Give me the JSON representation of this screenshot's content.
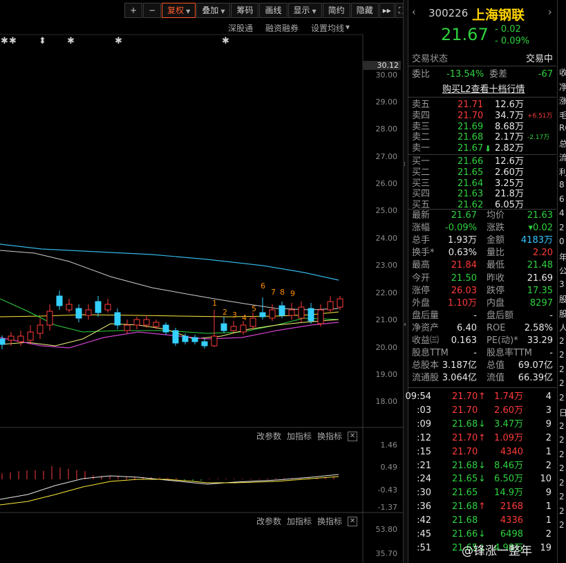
{
  "toolbar": {
    "buttons": [
      "+",
      "−",
      "复权",
      "叠加",
      "筹码",
      "画线",
      "显示",
      "简约",
      "隐藏"
    ],
    "icons": [
      "double-arrow-icon",
      "expand-icon"
    ]
  },
  "subbar": [
    "深股通",
    "融资融券",
    "设置均线"
  ],
  "price_axis": [
    "30.12",
    "30.00",
    "29.00",
    "28.00",
    "27.00",
    "26.00",
    "25.00",
    "24.00",
    "23.00",
    "22.00",
    "21.00",
    "20.00",
    "19.00",
    "18.00"
  ],
  "chart_markers": [
    "1",
    "2",
    "3",
    "4",
    "5",
    "6",
    "7",
    "8",
    "9"
  ],
  "panel_bar": {
    "params": "改参数",
    "add": "加指标",
    "switch": "换指标"
  },
  "macd_axis": [
    "1.46",
    "0.49",
    "-0.43",
    "-1.37"
  ],
  "vol_axis": [
    "53.80",
    "35.70"
  ],
  "stock": {
    "code": "300226",
    "name": "上海钢联",
    "price": "21.67",
    "change": "- 0.02",
    "change_pct": "- 0.09%"
  },
  "status": {
    "label": "交易状态",
    "value": "交易中"
  },
  "weibi": {
    "label1": "委比",
    "val1": "-13.54%",
    "label2": "委差",
    "val2": "-67"
  },
  "l2_link": "购买L2查看十档行情",
  "sells": [
    {
      "label": "卖五",
      "price": "21.71",
      "vol": "12.6万",
      "extra": ""
    },
    {
      "label": "卖四",
      "price": "21.70",
      "vol": "34.7万",
      "extra": "+6.51万"
    },
    {
      "label": "卖三",
      "price": "21.69",
      "vol": "8.68万",
      "extra": ""
    },
    {
      "label": "卖二",
      "price": "21.68",
      "vol": "2.17万",
      "extra": "-2.17万"
    },
    {
      "label": "卖一",
      "price": "21.67",
      "vol": "2.82万",
      "extra": ""
    }
  ],
  "buys": [
    {
      "label": "买一",
      "price": "21.66",
      "vol": "12.6万"
    },
    {
      "label": "买二",
      "price": "21.65",
      "vol": "2.60万"
    },
    {
      "label": "买三",
      "price": "21.64",
      "vol": "3.25万"
    },
    {
      "label": "买四",
      "price": "21.63",
      "vol": "21.8万"
    },
    {
      "label": "买五",
      "price": "21.62",
      "vol": "6.05万"
    }
  ],
  "stats": [
    {
      "l1": "最新",
      "v1": "21.67",
      "c1": "green",
      "l2": "均价",
      "v2": "21.63",
      "c2": "green"
    },
    {
      "l1": "涨幅",
      "v1": "-0.09%",
      "c1": "green",
      "l2": "涨跌",
      "v2": "▾0.02",
      "c2": "green"
    },
    {
      "l1": "总手",
      "v1": "1.93万",
      "c1": "white",
      "l2": "金额",
      "v2": "4183万",
      "c2": "cyan"
    },
    {
      "l1": "换手*",
      "v1": "0.63%",
      "c1": "white",
      "l2": "量比",
      "v2": "2.20",
      "c2": "red"
    },
    {
      "l1": "最高",
      "v1": "21.84",
      "c1": "red",
      "l2": "最低",
      "v2": "21.48",
      "c2": "green"
    },
    {
      "l1": "今开",
      "v1": "21.50",
      "c1": "green",
      "l2": "昨收",
      "v2": "21.69",
      "c2": "white"
    },
    {
      "l1": "涨停",
      "v1": "26.03",
      "c1": "red",
      "l2": "跌停",
      "v2": "17.35",
      "c2": "green"
    },
    {
      "l1": "外盘",
      "v1": "1.10万",
      "c1": "red",
      "l2": "内盘",
      "v2": "8297",
      "c2": "green"
    },
    {
      "l1": "盘后量",
      "v1": "-",
      "c1": "white",
      "l2": "盘后额",
      "v2": "-",
      "c2": "white"
    },
    {
      "l1": "净资产",
      "v1": "6.40",
      "c1": "white",
      "l2": "ROE",
      "v2": "2.58%",
      "c2": "white"
    },
    {
      "l1": "收益㈢",
      "v1": "0.163",
      "c1": "white",
      "l2": "PE(动)*",
      "v2": "33.29",
      "c2": "white"
    },
    {
      "l1": "股息TTM",
      "v1": "-",
      "c1": "white",
      "l2": "股息率TTM",
      "v2": "-",
      "c2": "white"
    },
    {
      "l1": "总股本",
      "v1": "3.187亿",
      "c1": "white",
      "l2": "总值",
      "v2": "69.07亿",
      "c2": "white"
    },
    {
      "l1": "流通股",
      "v1": "3.064亿",
      "c1": "white",
      "l2": "流值",
      "v2": "66.39亿",
      "c2": "white"
    }
  ],
  "ticks": [
    {
      "time": "09:54",
      "price": "21.70",
      "pc": "red",
      "arrow": "↑",
      "ac": "red",
      "vol": "1.74万",
      "vc": "red",
      "n": "4"
    },
    {
      "time": ":03",
      "price": "21.70",
      "pc": "red",
      "arrow": "",
      "ac": "",
      "vol": "2.60万",
      "vc": "red",
      "n": "3"
    },
    {
      "time": ":09",
      "price": "21.68",
      "pc": "green",
      "arrow": "↓",
      "ac": "green",
      "vol": "3.47万",
      "vc": "green",
      "n": "9"
    },
    {
      "time": ":12",
      "price": "21.70",
      "pc": "red",
      "arrow": "↑",
      "ac": "red",
      "vol": "1.09万",
      "vc": "red",
      "n": "2"
    },
    {
      "time": ":15",
      "price": "21.70",
      "pc": "red",
      "arrow": "",
      "ac": "",
      "vol": "4340",
      "vc": "red",
      "n": "1"
    },
    {
      "time": ":21",
      "price": "21.68",
      "pc": "green",
      "arrow": "↓",
      "ac": "green",
      "vol": "8.46万",
      "vc": "green",
      "n": "2"
    },
    {
      "time": ":24",
      "price": "21.65",
      "pc": "green",
      "arrow": "↓",
      "ac": "green",
      "vol": "6.50万",
      "vc": "green",
      "n": "10"
    },
    {
      "time": ":30",
      "price": "21.65",
      "pc": "green",
      "arrow": "",
      "ac": "",
      "vol": "14.9万",
      "vc": "green",
      "n": "9"
    },
    {
      "time": ":36",
      "price": "21.68",
      "pc": "green",
      "arrow": "↑",
      "ac": "red",
      "vol": "2168",
      "vc": "red",
      "n": "1"
    },
    {
      "time": ":42",
      "price": "21.68",
      "pc": "green",
      "arrow": "",
      "ac": "",
      "vol": "4336",
      "vc": "red",
      "n": "1"
    },
    {
      "time": ":45",
      "price": "21.66",
      "pc": "green",
      "arrow": "↓",
      "ac": "green",
      "vol": "6498",
      "vc": "green",
      "n": "2"
    },
    {
      "time": ":51",
      "price": "21.65",
      "pc": "green",
      "arrow": "↓",
      "ac": "green",
      "vol": "4.98万",
      "vc": "green",
      "n": "19"
    }
  ],
  "far_right": [
    "收",
    "净",
    "涨",
    "毛",
    "RO",
    "总",
    "流",
    "利",
    "8",
    "6",
    "4",
    "2",
    "0",
    "年",
    "公",
    "3",
    "股",
    "股",
    "人",
    "2",
    "2",
    "2",
    "2",
    "2",
    "日",
    "2",
    "2",
    "2",
    "2",
    "2",
    "2",
    "2",
    "2"
  ],
  "watermark": "@锋涨一整年"
}
